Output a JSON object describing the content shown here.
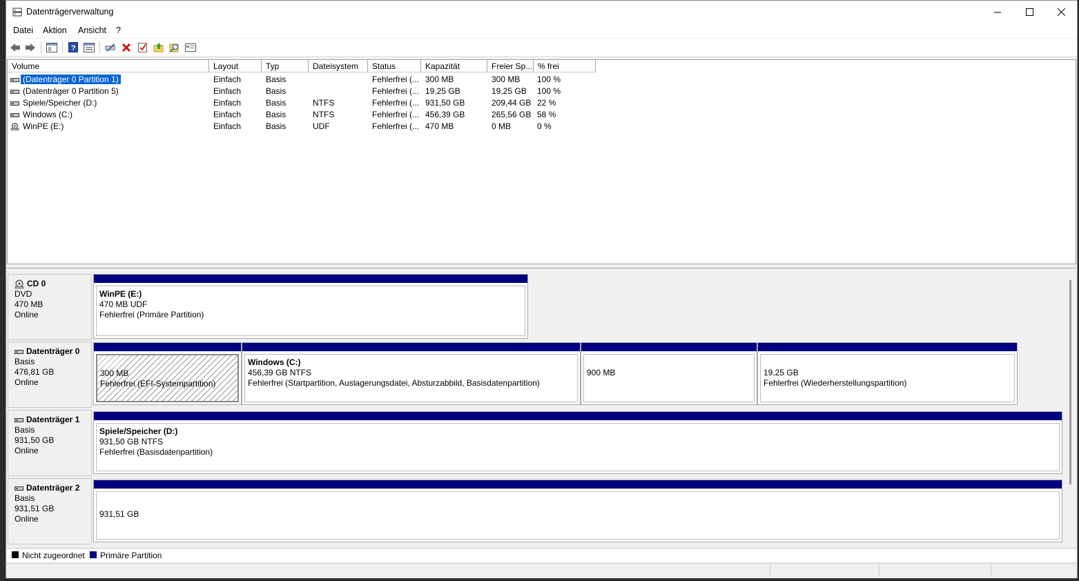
{
  "window": {
    "title": "Datenträgerverwaltung"
  },
  "menu": [
    "Datei",
    "Aktion",
    "Ansicht",
    "?"
  ],
  "toolbar": {
    "icons": [
      "back-arrow-icon",
      "forward-arrow-icon",
      "console-tree-icon",
      "help-icon",
      "properties-icon",
      "connect-icon",
      "delete-icon",
      "check-icon",
      "export-icon",
      "search-icon",
      "view-icon"
    ]
  },
  "volume_list": {
    "columns": [
      "Volume",
      "Layout",
      "Typ",
      "Dateisystem",
      "Status",
      "Kapazität",
      "Freier Sp...",
      "% frei"
    ],
    "rows": [
      {
        "volume": "(Datenträger 0 Partition 1)",
        "layout": "Einfach",
        "typ": "Basis",
        "fs": "",
        "status": "Fehlerfrei (...",
        "capacity": "300 MB",
        "free": "300 MB",
        "pct": "100 %",
        "selected": true,
        "icon": "disk"
      },
      {
        "volume": "(Datenträger 0 Partition 5)",
        "layout": "Einfach",
        "typ": "Basis",
        "fs": "",
        "status": "Fehlerfrei (...",
        "capacity": "19,25 GB",
        "free": "19,25 GB",
        "pct": "100 %",
        "selected": false,
        "icon": "disk"
      },
      {
        "volume": "Spiele/Speicher (D:)",
        "layout": "Einfach",
        "typ": "Basis",
        "fs": "NTFS",
        "status": "Fehlerfrei (...",
        "capacity": "931,50 GB",
        "free": "209,44 GB",
        "pct": "22 %",
        "selected": false,
        "icon": "disk"
      },
      {
        "volume": "Windows (C:)",
        "layout": "Einfach",
        "typ": "Basis",
        "fs": "NTFS",
        "status": "Fehlerfrei (...",
        "capacity": "456,39 GB",
        "free": "265,56 GB",
        "pct": "58 %",
        "selected": false,
        "icon": "disk"
      },
      {
        "volume": "WinPE (E:)",
        "layout": "Einfach",
        "typ": "Basis",
        "fs": "UDF",
        "status": "Fehlerfrei (...",
        "capacity": "470 MB",
        "free": "0 MB",
        "pct": "0 %",
        "selected": false,
        "icon": "cd"
      }
    ]
  },
  "disks": [
    {
      "name": "CD 0",
      "type": "DVD",
      "size": "470 MB",
      "state": "Online",
      "icon": "cd",
      "partitions": [
        {
          "title": "WinPE  (E:)",
          "size": "470 MB UDF",
          "status": "Fehlerfrei (Primäre Partition)",
          "hatched": false
        }
      ]
    },
    {
      "name": "Datenträger 0",
      "type": "Basis",
      "size": "476,81 GB",
      "state": "Online",
      "icon": "disk",
      "partitions": [
        {
          "title": "",
          "size": "300 MB",
          "status": "Fehlerfrei (EFI-Systempartition)",
          "hatched": true
        },
        {
          "title": "Windows  (C:)",
          "size": "456,39 GB NTFS",
          "status": "Fehlerfrei (Startpartition, Auslagerungsdatei, Absturzabbild, Basisdatenpartition)",
          "hatched": false
        },
        {
          "title": "",
          "size": "900 MB",
          "status": "",
          "hatched": false
        },
        {
          "title": "",
          "size": "19,25 GB",
          "status": "Fehlerfrei (Wiederherstellungspartition)",
          "hatched": false
        }
      ]
    },
    {
      "name": "Datenträger 1",
      "type": "Basis",
      "size": "931,50 GB",
      "state": "Online",
      "icon": "disk",
      "partitions": [
        {
          "title": "Spiele/Speicher  (D:)",
          "size": "931,50 GB NTFS",
          "status": "Fehlerfrei (Basisdatenpartition)",
          "hatched": false
        }
      ]
    },
    {
      "name": "Datenträger 2",
      "type": "Basis",
      "size": "931,51 GB",
      "state": "Online",
      "icon": "disk",
      "partitions": [
        {
          "title": "",
          "size": "931,51 GB",
          "status": "",
          "hatched": false
        }
      ]
    }
  ],
  "legend": [
    {
      "label": "Nicht zugeordnet",
      "color": "#000000"
    },
    {
      "label": "Primäre Partition",
      "color": "#00007f"
    }
  ]
}
